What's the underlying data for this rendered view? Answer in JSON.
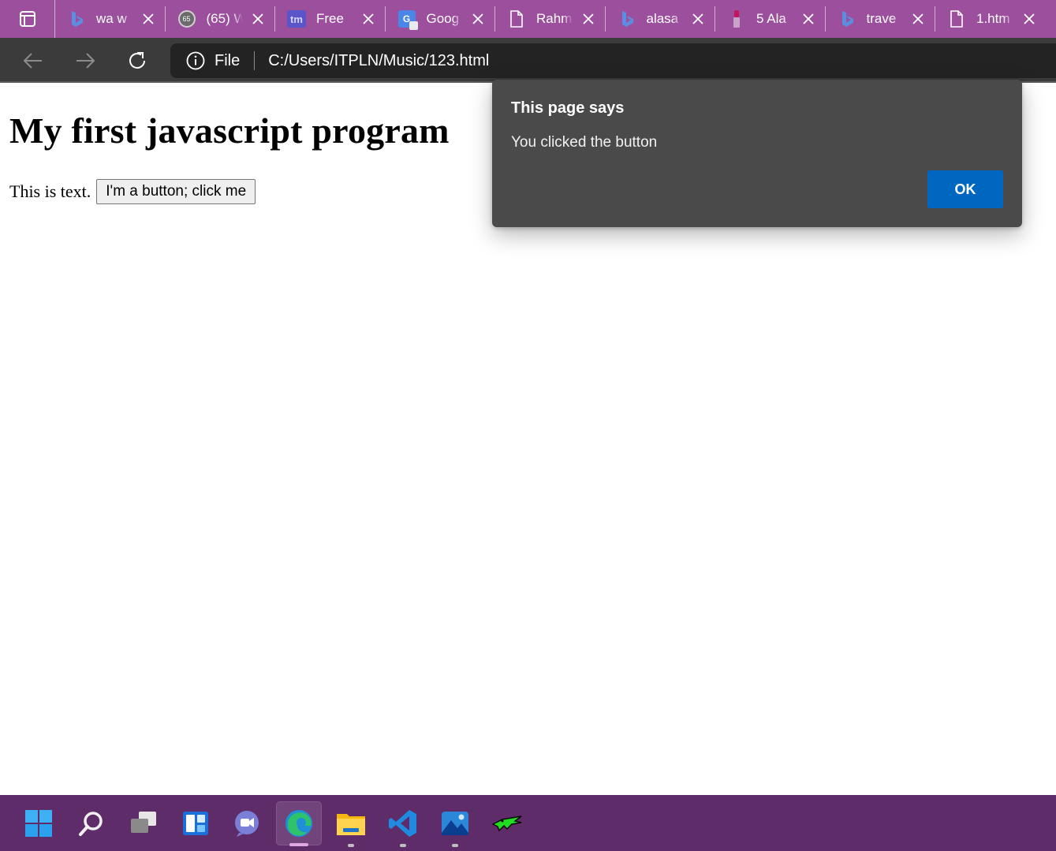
{
  "browser": {
    "tabs": [
      {
        "title": "wa w",
        "icon": "bing-icon"
      },
      {
        "title": "(65) W",
        "icon": "whatsapp-icon"
      },
      {
        "title": "Free",
        "icon": "tm-icon"
      },
      {
        "title": "Goog",
        "icon": "google-translate-icon"
      },
      {
        "title": "Rahm",
        "icon": "page-icon"
      },
      {
        "title": "alasa",
        "icon": "bing-icon"
      },
      {
        "title": "5 Ala",
        "icon": "lipstick-icon"
      },
      {
        "title": "trave",
        "icon": "bing-icon"
      },
      {
        "title": "1.htm",
        "icon": "page-icon"
      }
    ],
    "address_bar": {
      "site_label": "File",
      "url": "C:/Users/ITPLN/Music/123.html"
    }
  },
  "page": {
    "heading": "My first javascript program",
    "text": "This is text.",
    "button_label": "I'm a button; click me"
  },
  "dialog": {
    "title": "This page says",
    "message": "You clicked the button",
    "ok_label": "OK",
    "accent": "#0067c0"
  },
  "taskbar": {
    "icons": [
      "windows-start-icon",
      "search-icon",
      "task-view-icon",
      "widgets-icon",
      "chat-icon",
      "edge-icon",
      "file-explorer-icon",
      "vscode-icon",
      "photos-icon",
      "crocodile-app-icon"
    ]
  },
  "colors": {
    "tabstrip": "#9b4f9c",
    "toolbar": "#3b3b3b",
    "taskbar": "#5e2c69",
    "dialog_bg": "#4a4a4a"
  }
}
